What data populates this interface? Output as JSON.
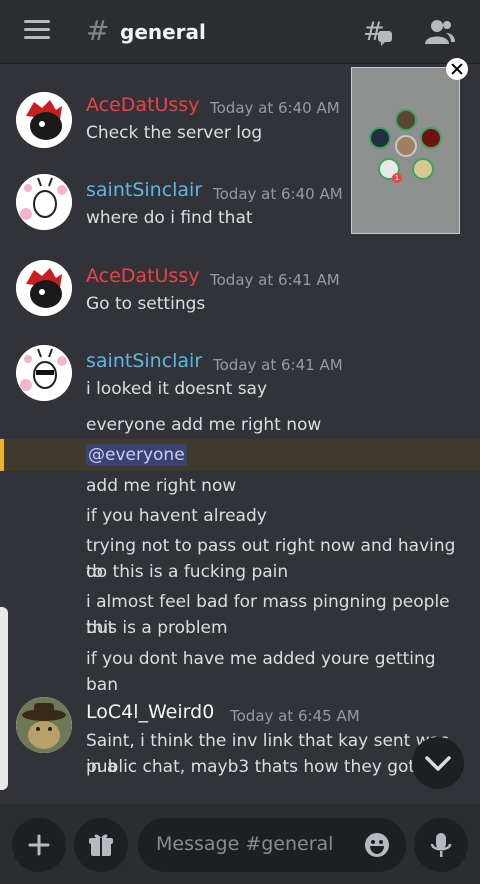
{
  "header": {
    "hash_symbol": "#",
    "channel_name": "general"
  },
  "messages": [
    {
      "username": "AceDatUssy",
      "username_color": "#ed4245",
      "timestamp": "Today at 6:40 AM",
      "lines": [
        "Check the server log"
      ]
    },
    {
      "username": "saintSinclair",
      "username_color": "#5cb8e6",
      "timestamp": "Today at 6:40 AM",
      "lines": [
        "where do i find that"
      ]
    },
    {
      "username": "AceDatUssy",
      "username_color": "#ed4245",
      "timestamp": "Today at 6:41 AM",
      "lines": [
        "Go to settings"
      ]
    },
    {
      "username": "saintSinclair",
      "username_color": "#5cb8e6",
      "timestamp": "Today at 6:41 AM",
      "lines": [
        "i looked it doesnt say",
        "everyone add me right now",
        "@everyone",
        "add me right now",
        "if you havent already",
        "trying not to pass out right now and having to",
        "do this is a fucking pain",
        "i almost feel bad for mass pingning people but",
        "this is a problem",
        "if you dont have me added youre getting ban"
      ]
    },
    {
      "username": "LoC4l_Weird0",
      "username_color": "#f2f3f5",
      "timestamp": "Today at 6:45 AM",
      "lines": [
        "Saint, i think the inv link that kay sent was in a",
        "public chat, mayb3 thats how they got in"
      ]
    }
  ],
  "voice_popup": {
    "speaking_color": "#3ba55d",
    "badge_count": "1"
  },
  "composer": {
    "placeholder": "Message #general"
  },
  "colors": {
    "background": "#313338",
    "header": "#2b2d31",
    "mention_highlight": "#f0b232"
  }
}
